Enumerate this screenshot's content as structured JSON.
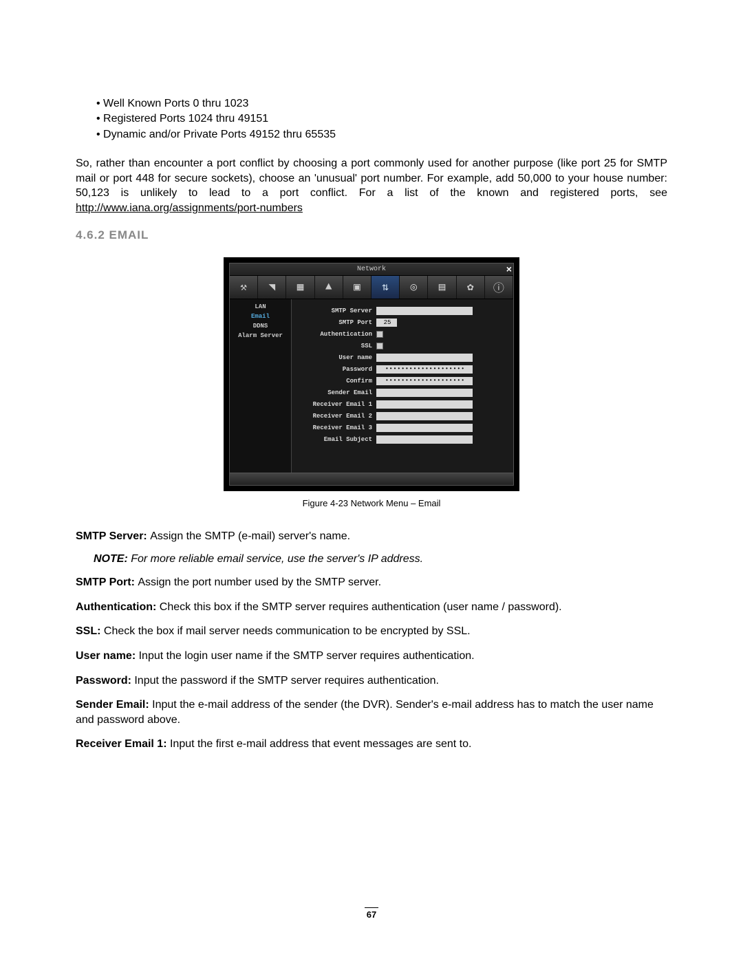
{
  "bullets": {
    "b1": "• Well Known Ports 0 thru 1023",
    "b2": "• Registered Ports 1024 thru 49151",
    "b3": "• Dynamic and/or Private Ports 49152 thru 65535"
  },
  "paragraph": {
    "pre": "So, rather than encounter a port conflict by choosing a port commonly used for another purpose (like port 25 for SMTP mail or port 448 for secure sockets), choose an 'unusual' port number. For example, add 50,000 to your house number: 50,123 is unlikely to lead to a port conflict. For a list of the known and registered ports, see ",
    "link": "http://www.iana.org/assignments/port-numbers"
  },
  "heading": "4.6.2   EMAIL",
  "dvr": {
    "title": "Network",
    "close": "×",
    "sidebar": [
      "LAN",
      "Email",
      "DDNS",
      "Alarm Server"
    ],
    "form": {
      "smtp_server": "SMTP Server",
      "smtp_port": "SMTP Port",
      "smtp_port_value": "25",
      "authentication": "Authentication",
      "ssl": "SSL",
      "user_name": "User name",
      "password": "Password",
      "password_value": "••••••••••••••••••••",
      "confirm": "Confirm",
      "confirm_value": "••••••••••••••••••••",
      "sender": "Sender Email",
      "r1": "Receiver Email 1",
      "r2": "Receiver Email 2",
      "r3": "Receiver Email 3",
      "subject": "Email Subject"
    }
  },
  "caption": "Figure 4-23  Network Menu – Email",
  "defs": {
    "smtp_server": {
      "k": "SMTP Server: ",
      "v": "Assign the SMTP (e-mail) server's name."
    },
    "note": {
      "k": "NOTE:",
      "v": " For more reliable email service, use the server's IP address."
    },
    "smtp_port": {
      "k": "SMTP Port: ",
      "v": "Assign the port number used by the SMTP server."
    },
    "auth": {
      "k": "Authentication: ",
      "v": "Check this box if the SMTP server requires authentication (user name / password)."
    },
    "ssl": {
      "k": "SSL: ",
      "v": "Check the box if mail server needs communication to be encrypted by SSL."
    },
    "user": {
      "k": "User name: ",
      "v": "Input the login user name if the SMTP server requires authentication."
    },
    "pass": {
      "k": "Password: ",
      "v": "Input the password if the SMTP server requires authentication."
    },
    "sender": {
      "k": "Sender Email: ",
      "v": "Input the e-mail address of the sender (the DVR). Sender's e-mail address has to match the user name and password above."
    },
    "r1": {
      "k": "Receiver Email 1: ",
      "v": "Input the first e-mail address that event messages are sent to."
    }
  },
  "page": "67"
}
